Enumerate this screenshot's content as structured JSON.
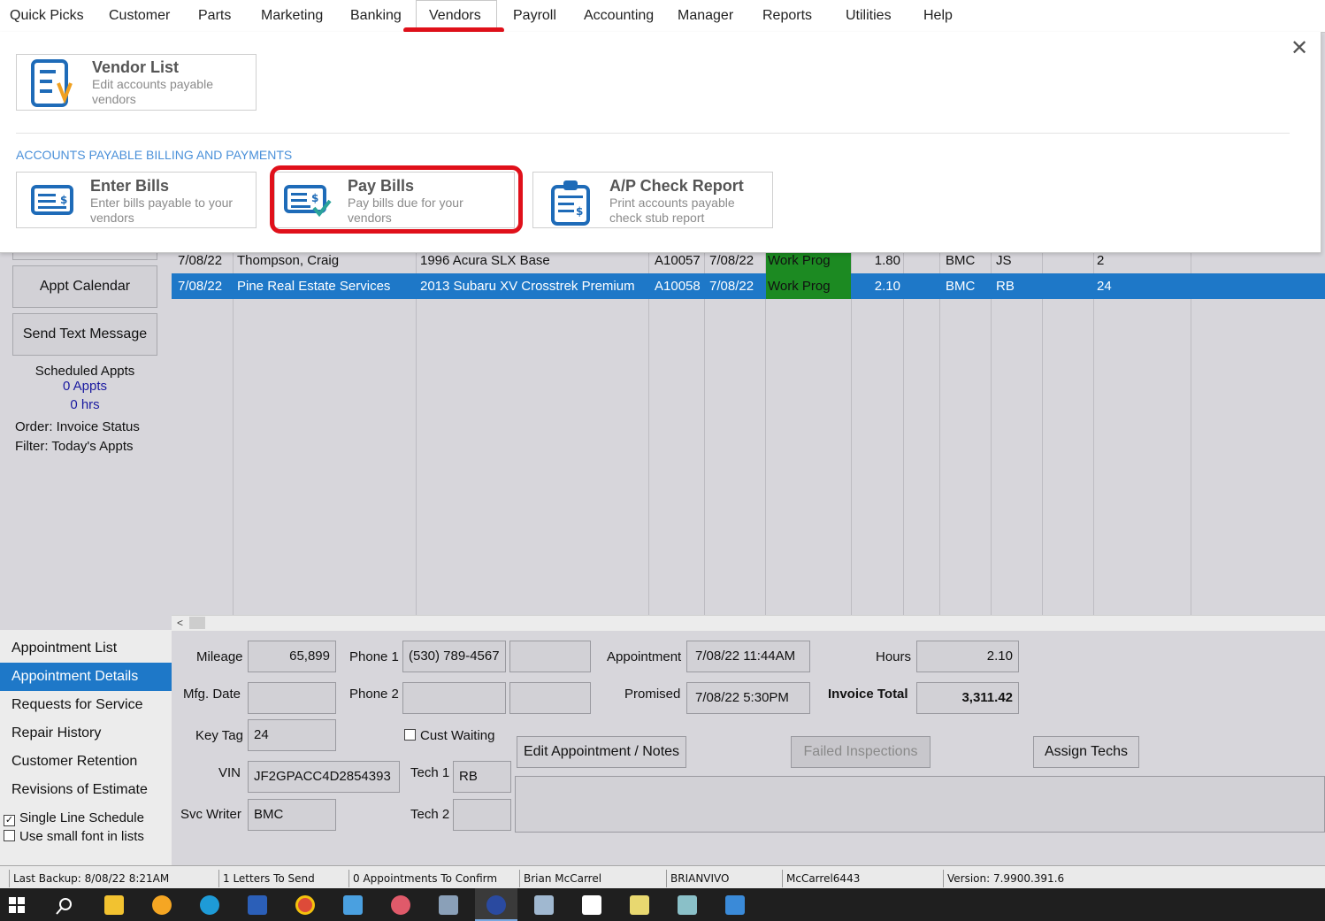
{
  "menu": {
    "items": [
      "Quick Picks",
      "Customer",
      "Parts",
      "Marketing",
      "Banking",
      "Vendors",
      "Payroll",
      "Accounting",
      "Manager",
      "Reports",
      "Utilities",
      "Help"
    ],
    "active": "Vendors"
  },
  "panel": {
    "vendor_list": {
      "title": "Vendor List",
      "desc": "Edit accounts payable vendors"
    },
    "section_heading": "ACCOUNTS PAYABLE BILLING AND PAYMENTS",
    "enter_bills": {
      "title": "Enter Bills",
      "desc": "Enter bills payable to your vendors"
    },
    "pay_bills": {
      "title": "Pay Bills",
      "desc": "Pay bills due for your vendors"
    },
    "ap_check_report": {
      "title": "A/P Check Report",
      "desc": "Print accounts payable check stub report"
    },
    "close_glyph": "✕"
  },
  "sidebar": {
    "appt_calendar": "Appt Calendar",
    "send_text": "Send Text Message",
    "scheduled_label": "Scheduled Appts",
    "appts_count": "0 Appts",
    "hrs": "0 hrs",
    "order": "Order: Invoice Status",
    "filter": "Filter: Today's Appts",
    "nav": [
      "Appointment List",
      "Appointment Details",
      "Requests for Service",
      "Repair History",
      "Customer Retention",
      "Revisions of Estimate"
    ],
    "nav_active": "Appointment Details",
    "single_line": "Single Line Schedule",
    "single_line_checked": true,
    "small_font": "Use small font in lists",
    "small_font_checked": false
  },
  "grid": {
    "rows": [
      {
        "date": "7/08/22",
        "customer": "Thompson, Craig",
        "vehicle": "1996 Acura  SLX Base",
        "invoice": "A10057",
        "date2": "7/08/22",
        "status": "Work Prog",
        "hours": "1.80",
        "writer": "BMC",
        "tech": "JS",
        "num": "2",
        "selected": false
      },
      {
        "date": "7/08/22",
        "customer": "Pine Real Estate Services",
        "vehicle": "2013 Subaru  XV Crosstrek Premium",
        "invoice": "A10058",
        "date2": "7/08/22",
        "status": "Work Prog",
        "hours": "2.10",
        "writer": "BMC",
        "tech": "RB",
        "num": "24",
        "selected": true
      }
    ],
    "status_color": "#1c8a22",
    "select_color": "#1e78c8",
    "scroll_left": "<"
  },
  "details": {
    "mileage_label": "Mileage",
    "mileage": "65,899",
    "mfg_label": "Mfg. Date",
    "mfg": "",
    "keytag_label": "Key Tag",
    "keytag": "24",
    "vin_label": "VIN",
    "vin": "JF2GPACC4D2854393",
    "svc_label": "Svc Writer",
    "svc": "BMC",
    "phone1_label": "Phone 1",
    "phone1": "(530) 789-4567",
    "phone1_ext": "",
    "phone2_label": "Phone 2",
    "phone2": "",
    "phone2_ext": "",
    "cust_waiting": "Cust Waiting",
    "tech1_label": "Tech 1",
    "tech1": "RB",
    "tech2_label": "Tech 2",
    "tech2": "",
    "appt_label": "Appointment",
    "appt": "7/08/22 11:44AM",
    "promised_label": "Promised",
    "promised": "7/08/22  5:30PM",
    "hours_label": "Hours",
    "hours": "2.10",
    "total_label": "Invoice Total",
    "total": "3,311.42",
    "edit_btn": "Edit Appointment / Notes",
    "failed_btn": "Failed Inspections",
    "assign_btn": "Assign Techs",
    "notes": ""
  },
  "statusbar": {
    "backup": "Last Backup:  8/08/22    8:21AM",
    "letters": "1 Letters To Send",
    "confirm": "0 Appointments To Confirm",
    "user": "Brian McCarrel",
    "machine": "BRIANVIVO",
    "account": "McCarrel6443",
    "version": "Version:  7.9900.391.6"
  },
  "taskbar": {
    "icons": [
      "windows-start-icon",
      "search-icon",
      "file-explorer-icon",
      "weather-icon",
      "edge-icon",
      "word-icon",
      "chrome-icon",
      "contact-card-icon",
      "paint-icon",
      "calculator-icon",
      "shop-app-icon",
      "box-3d-icon",
      "infinity-app-icon",
      "pen-app-icon",
      "notes-app-icon",
      "photos-icon"
    ]
  }
}
